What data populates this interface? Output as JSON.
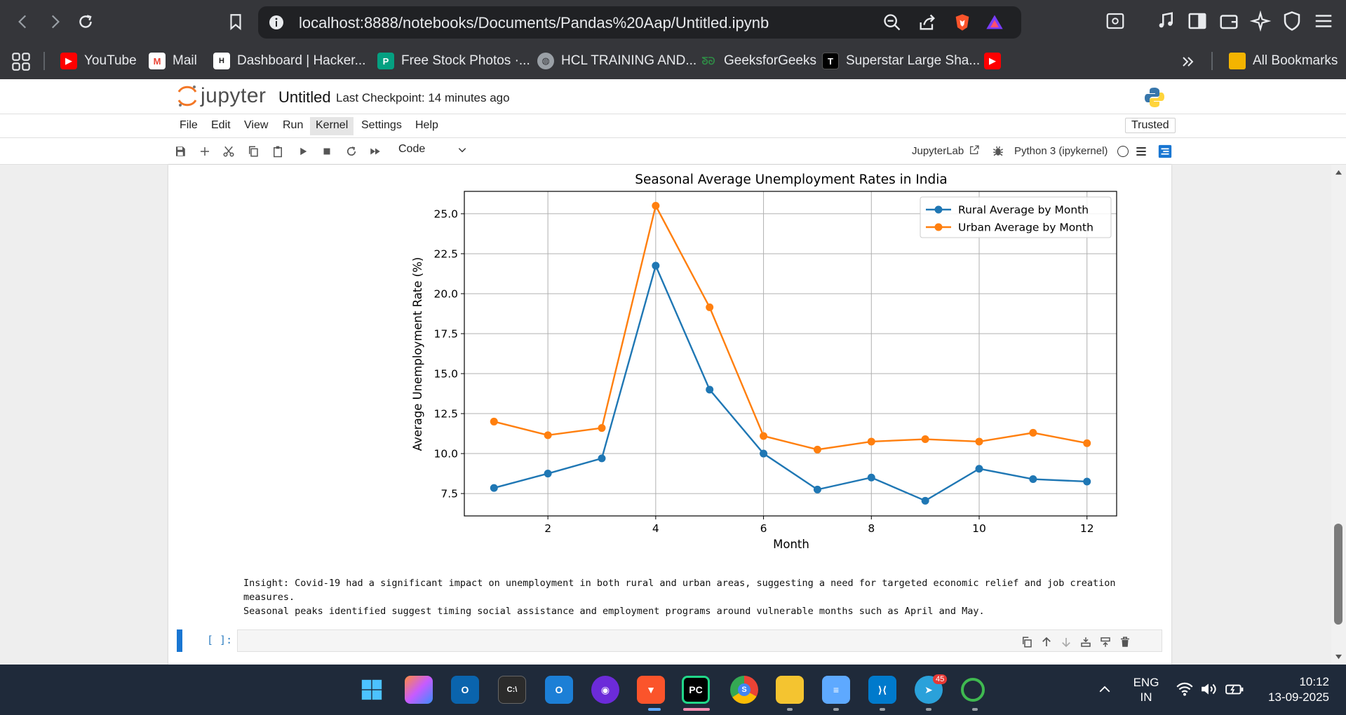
{
  "browser": {
    "url": "localhost:8888/notebooks/Documents/Pandas%20Aap/Untitled.ipynb",
    "bookmarks": [
      {
        "label": "YouTube",
        "icon": "youtube-icon",
        "color": "#ff0000"
      },
      {
        "label": "Mail",
        "icon": "gmail-icon",
        "color": "#ea4335"
      },
      {
        "label": "Dashboard | Hacker...",
        "icon": "hackerrank-icon",
        "color": "#1ba94c"
      },
      {
        "label": "Free Stock Photos ·...",
        "icon": "pexels-icon",
        "color": "#05a081"
      },
      {
        "label": "HCL TRAINING AND...",
        "icon": "globe-icon",
        "color": "#9aa0a6"
      },
      {
        "label": "GeeksforGeeks",
        "icon": "geeksforgeeks-icon",
        "color": "#2f8d46"
      },
      {
        "label": "Superstar Large Sha...",
        "icon": "superstar-icon",
        "color": "#000000"
      }
    ],
    "all_bookmarks": "All Bookmarks"
  },
  "jupyter": {
    "logo_text": "jupyter",
    "title": "Untitled",
    "checkpoint": "Last Checkpoint: 14 minutes ago",
    "menus": [
      "File",
      "Edit",
      "View",
      "Run",
      "Kernel",
      "Settings",
      "Help"
    ],
    "active_menu": "Kernel",
    "trusted": "Trusted",
    "cell_type": "Code",
    "jupyterlab_link": "JupyterLab",
    "kernel": "Python 3 (ipykernel)",
    "empty_cell_prompt": "[ ]:"
  },
  "insight": {
    "line1": "Insight: Covid-19 had a significant impact on unemployment in both rural and urban areas, suggesting a need for targeted economic relief and job creation measures.",
    "line2": "Seasonal peaks identified suggest timing social assistance and employment programs around vulnerable months such as April and May."
  },
  "chart_data": {
    "type": "line",
    "title": "Seasonal Average Unemployment Rates in India",
    "xlabel": "Month",
    "ylabel": "Average Unemployment Rate (%)",
    "x": [
      1,
      2,
      3,
      4,
      5,
      6,
      7,
      8,
      9,
      10,
      11,
      12
    ],
    "xlim": [
      0.45,
      12.55
    ],
    "ylim": [
      6.1,
      26.4
    ],
    "xticks": [
      2,
      4,
      6,
      8,
      10,
      12
    ],
    "yticks": [
      7.5,
      10.0,
      12.5,
      15.0,
      17.5,
      20.0,
      22.5,
      25.0
    ],
    "grid": true,
    "legend": "top-right",
    "series": [
      {
        "name": "Rural Average by Month",
        "color": "#1f77b4",
        "values": [
          7.85,
          8.75,
          9.7,
          21.75,
          14.0,
          10.0,
          7.75,
          8.5,
          7.05,
          9.05,
          8.4,
          8.25
        ]
      },
      {
        "name": "Urban Average by Month",
        "color": "#ff7f0e",
        "values": [
          12.0,
          11.15,
          11.6,
          25.5,
          19.15,
          11.1,
          10.25,
          10.75,
          10.9,
          10.75,
          11.3,
          10.65
        ]
      }
    ]
  },
  "taskbar": {
    "apps": [
      {
        "icon": "windows-start-icon",
        "color": "#0078d4"
      },
      {
        "icon": "copilot-icon",
        "color": "#c75bff"
      },
      {
        "icon": "outlook-icon",
        "color": "#0a64ad"
      },
      {
        "icon": "terminal-icon",
        "color": "#2b2b2b"
      },
      {
        "icon": "outlook-new-icon",
        "color": "#1c7fd6"
      },
      {
        "icon": "podcast-icon",
        "color": "#6c2bd9"
      },
      {
        "icon": "brave-icon",
        "color": "#fb542b"
      },
      {
        "icon": "pycharm-icon",
        "color": "#21d789"
      },
      {
        "icon": "chrome-icon",
        "color": "#4285f4"
      },
      {
        "icon": "file-explorer-icon",
        "color": "#f4c430"
      },
      {
        "icon": "notepad-icon",
        "color": "#5ea9ff"
      },
      {
        "icon": "vscode-icon",
        "color": "#007acc"
      },
      {
        "icon": "telegram-icon",
        "color": "#2aa1da"
      },
      {
        "icon": "refresh-app-icon",
        "color": "#3fb950"
      }
    ],
    "telegram_badge": "45",
    "chrome_badge": "S",
    "lang_line1": "ENG",
    "lang_line2": "IN",
    "time": "10:12",
    "date": "13-09-2025"
  }
}
